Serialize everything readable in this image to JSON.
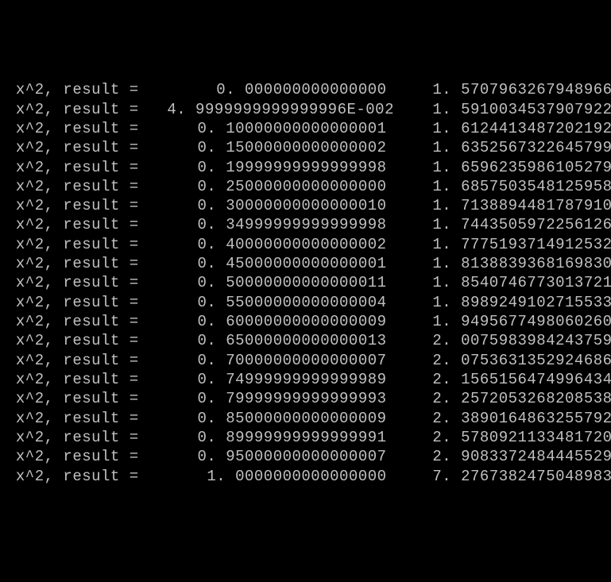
{
  "label_prefix": " x^2, result = ",
  "rows": [
    {
      "c1": "  0. 000000000000000",
      "c2": "1. 5707963267948966"
    },
    {
      "c1": "  4. 9999999999999996E-002",
      "c2": "1. 5910034537907922"
    },
    {
      "c1": "0. 10000000000000001",
      "c2": "1. 6124413487202192"
    },
    {
      "c1": "0. 15000000000000002",
      "c2": "1. 6352567322645799"
    },
    {
      "c1": "0. 19999999999999998",
      "c2": "1. 6596235986105279"
    },
    {
      "c1": "0. 25000000000000000",
      "c2": "1. 6857503548125958"
    },
    {
      "c1": "0. 30000000000000010",
      "c2": "1. 7138894481787910"
    },
    {
      "c1": "0. 34999999999999998",
      "c2": "1. 7443505972256126"
    },
    {
      "c1": "0. 40000000000000002",
      "c2": "1. 7775193714912532"
    },
    {
      "c1": "0. 45000000000000001",
      "c2": "1. 8138839368169830"
    },
    {
      "c1": "0. 50000000000000011",
      "c2": "1. 8540746773013721"
    },
    {
      "c1": "0. 55000000000000004",
      "c2": "1. 8989249102715533"
    },
    {
      "c1": "0. 60000000000000009",
      "c2": "1. 9495677498060260"
    },
    {
      "c1": "0. 65000000000000013",
      "c2": "2. 0075983984243759"
    },
    {
      "c1": "0. 70000000000000007",
      "c2": "2. 0753631352924686"
    },
    {
      "c1": "0. 74999999999999989",
      "c2": "2. 1565156474996434"
    },
    {
      "c1": "0. 79999999999999993",
      "c2": "2. 2572053268208538"
    },
    {
      "c1": "0. 85000000000000009",
      "c2": "2. 3890164863255792"
    },
    {
      "c1": "0. 89999999999999991",
      "c2": "2. 5780921133481720"
    },
    {
      "c1": "0. 95000000000000007",
      "c2": "2. 9083372484445529"
    },
    {
      "c1": "  1. 0000000000000000",
      "c2": "7. 2767382475048983"
    }
  ]
}
